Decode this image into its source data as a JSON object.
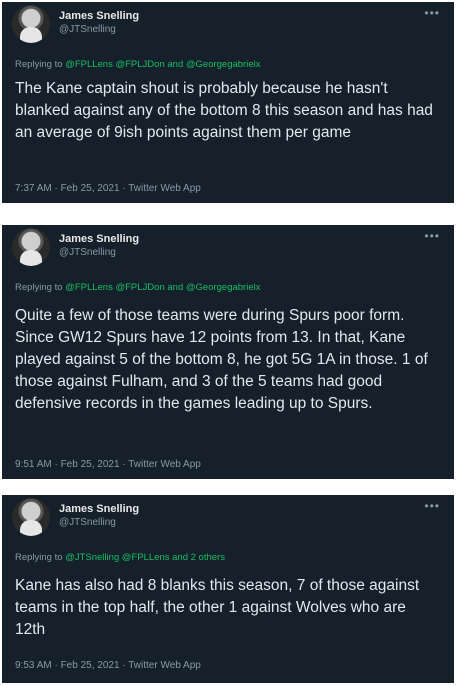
{
  "tweets": [
    {
      "author": "James Snelling",
      "handle": "@JTSnelling",
      "reply_prefix": "Replying to",
      "reply_mentions": "@FPLLens @FPLJDon",
      "reply_and": "and",
      "reply_last": "@Georgegabrielx",
      "text": "The Kane captain shout is probably because he hasn't blanked against any of the bottom 8 this season and has had an average of 9ish points against them per game",
      "timestamp": "7:37 AM · Feb 25, 2021 · Twitter Web App"
    },
    {
      "author": "James Snelling",
      "handle": "@JTSnelling",
      "reply_prefix": "Replying to",
      "reply_mentions": "@FPLLens @FPLJDon",
      "reply_and": "and",
      "reply_last": "@Georgegabrielx",
      "text": "Quite a few of those teams were during Spurs poor form. Since GW12 Spurs have 12 points from 13. In that, Kane played against 5 of the bottom 8, he got 5G 1A in those. 1 of those against Fulham, and 3 of the 5 teams had good defensive records in the games leading up to Spurs.",
      "timestamp": "9:51 AM · Feb 25, 2021 · Twitter Web App"
    },
    {
      "author": "James Snelling",
      "handle": "@JTSnelling",
      "reply_prefix": "Replying to",
      "reply_mentions": "@JTSnelling @FPLLens",
      "reply_and": "and",
      "reply_last": "2 others",
      "text": "Kane has also had 8 blanks this season, 7 of those against teams in the top half, the other 1 against Wolves who are 12th",
      "timestamp": "9:53 AM · Feb 25, 2021 · Twitter Web App"
    }
  ],
  "icons": {
    "more": "more-horizontal-icon"
  },
  "colors": {
    "background": "#15202b",
    "mention": "#17bf63",
    "secondary_text": "#8899a6",
    "primary_text": "#e1e8ed"
  }
}
